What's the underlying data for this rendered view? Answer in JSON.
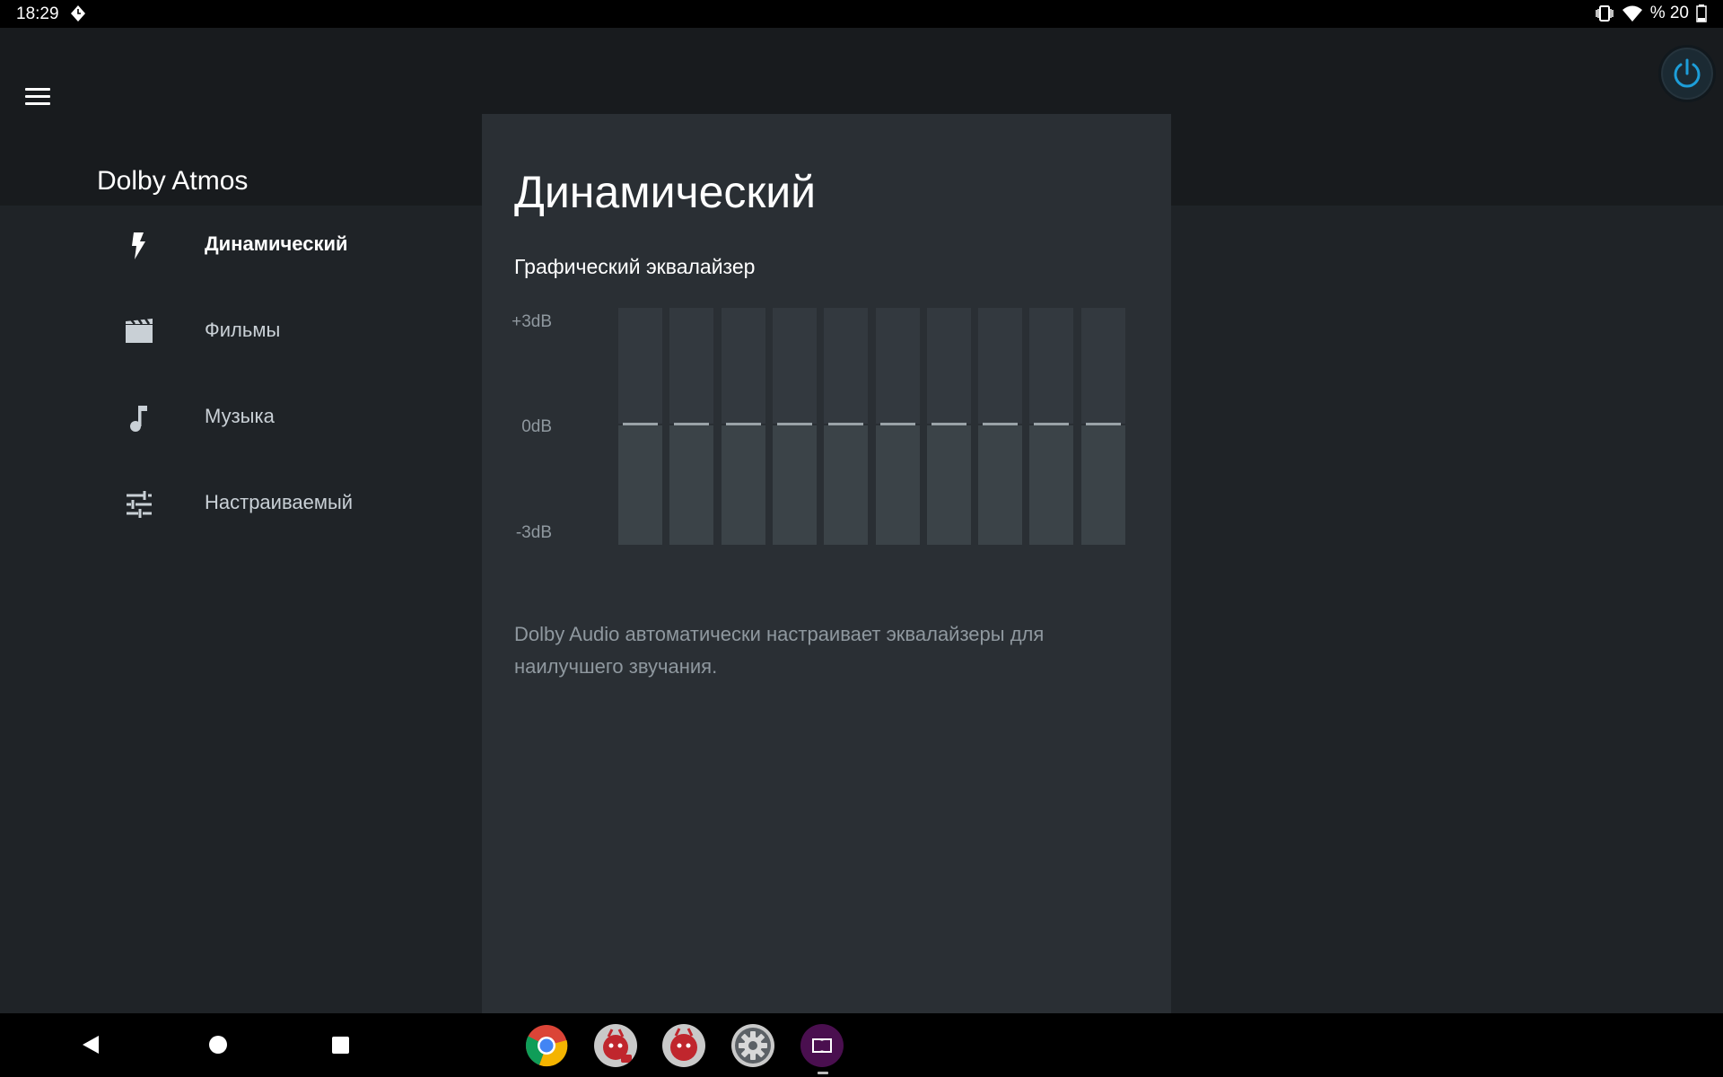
{
  "status_bar": {
    "time": "18:29",
    "battery_text": "% 20",
    "icons": [
      "notification-diamond-icon",
      "vibrate-icon",
      "wifi-icon",
      "battery-icon"
    ]
  },
  "header": {
    "app_title": "Dolby Atmos",
    "menu_icon": "hamburger-menu-icon",
    "power_icon": "power-icon",
    "accent_color": "#1d9ed9"
  },
  "sidebar": {
    "items": [
      {
        "label": "Динамический",
        "icon": "lightning-bolt-icon",
        "active": true
      },
      {
        "label": "Фильмы",
        "icon": "movie-clapperboard-icon",
        "active": false
      },
      {
        "label": "Музыка",
        "icon": "music-note-icon",
        "active": false
      },
      {
        "label": "Настраиваемый",
        "icon": "equalizer-sliders-icon",
        "active": false
      }
    ]
  },
  "main": {
    "title": "Динамический",
    "equalizer": {
      "title": "Графический эквалайзер",
      "labels": {
        "top": "+3dB",
        "middle": "0dB",
        "bottom": "-3dB"
      },
      "band_count": 10,
      "band_levels_db": [
        0,
        0,
        0,
        0,
        0,
        0,
        0,
        0,
        0,
        0
      ]
    },
    "description": "Dolby Audio автоматически настраивает эквалайзеры для наилучшего звучания."
  },
  "nav_bar": {
    "buttons": [
      "back-icon",
      "home-icon",
      "recents-icon"
    ],
    "dock_apps": [
      "chrome-app-icon",
      "antutu-3d-app-icon",
      "antutu-app-icon",
      "settings-app-icon",
      "dolby-app-icon"
    ]
  }
}
